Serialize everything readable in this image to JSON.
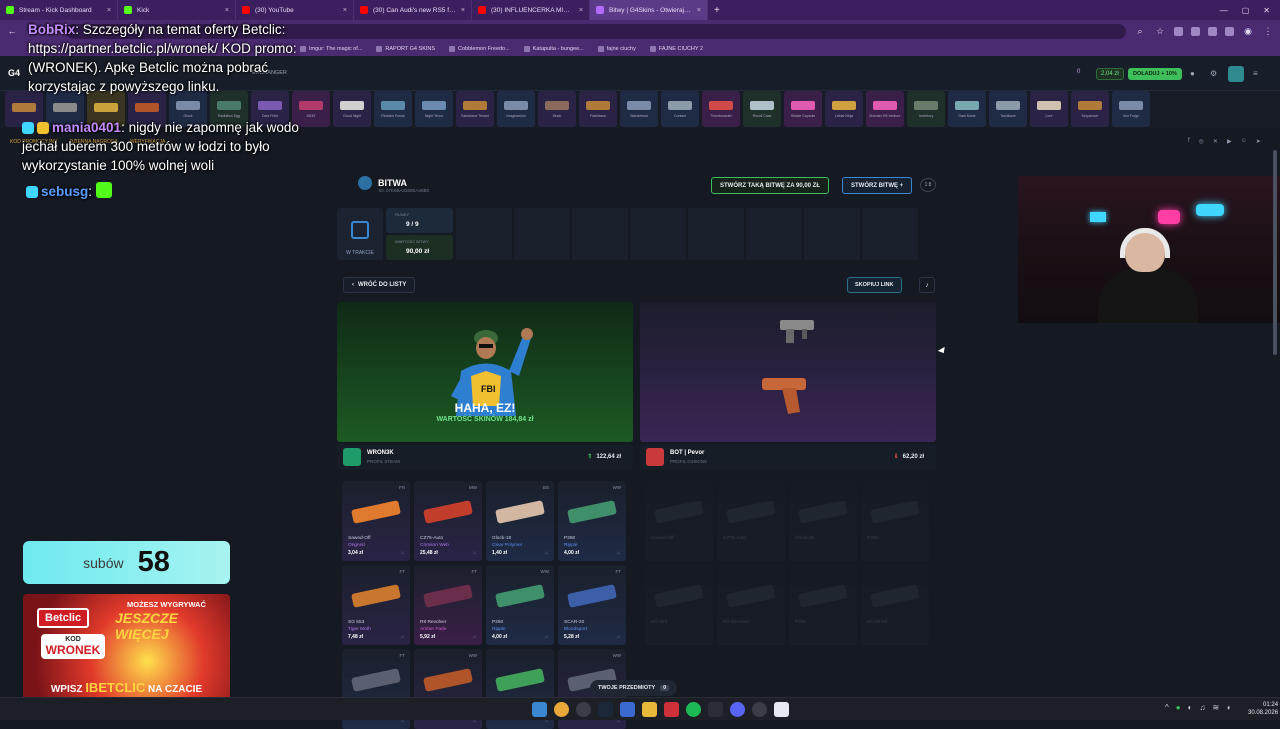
{
  "browser": {
    "tabs": [
      {
        "title": "Stream - Kick Dashboard",
        "color": "#53fc18",
        "active": false
      },
      {
        "title": "Kick",
        "color": "#53fc18",
        "active": false
      },
      {
        "title": "(30) YouTube",
        "color": "#ff0000",
        "active": false
      },
      {
        "title": "(30) Can Audi's new RS5 finally",
        "color": "#ff0000",
        "active": false
      },
      {
        "title": "(30) INFLUENCERKA MIAŻDŻY",
        "color": "#ff0000",
        "active": false
      },
      {
        "title": "Bitwy | G4Skins - Otwieraj skrz",
        "color": "#b06bff",
        "active": true
      }
    ],
    "new_tab": "+",
    "bookmarks": [
      "Imgur: The magic of...",
      "RAPORT G4 SKINS",
      "Cobblemon Freedo...",
      "Katapulta - bungee...",
      "fajne ciuchy",
      "FAJNE CIUCHY 2"
    ]
  },
  "chat": {
    "line1_user": "BobRix",
    "line1_text": ": Szczegóły na temat oferty Betclic: https://partner.betclic.pl/wronek/ KOD promo: (WRONEK). Apkę Betclic można pobrać korzystając z powyższego linku.",
    "line2_user": "mania0401",
    "line2_text": ": nigdy nie zapomnę jak wodo jechał uberem 300 metrów w łodzi to było wykorzystanie 100% wolnej woli",
    "line3_user": "sebusg",
    "line3_text": ":"
  },
  "site": {
    "exchanger": "EXCHANGER",
    "balance": "2,04 zł",
    "deposit": "DOŁADUJ + 10%",
    "coins": "0",
    "promo_links": [
      "KOD PROMOCYJNY",
      "DZIENNA NAGRODA",
      "WERYFIKACJA"
    ]
  },
  "battle": {
    "title": "BITWA",
    "id": "ID: 07E6BA3358EA45B0",
    "create_same": "STWÓRZ TAKĄ BITWĘ ZA 90,00 ZŁ",
    "create_new": "STWÓRZ BITWĘ",
    "fair_badge": "1:8",
    "status": "W TRAKCIE",
    "rounds_label": "RUNDY",
    "rounds_value": "9 / 9",
    "value_label": "WARTOŚĆ BITWY",
    "value_value": "90,00 zł",
    "back": "WRÓĆ DO LISTY",
    "copy_link": "SKOPIUJ LINK",
    "winner_banner": "HAHA, EZ!",
    "winner_skins_value": "WARTOŚĆ SKINÓW 184,84 zł",
    "your_items": "TWOJE PRZEDMIOTY",
    "your_items_count": "0"
  },
  "players": [
    {
      "name": "WRON3K",
      "sub": "PROFIL STEAM",
      "total": "122,64 zł",
      "avatar_color": "#1d9c6a"
    },
    {
      "name": "BOT | Pevor",
      "sub": "PROFIL G4SKINS",
      "total": "62,20 zł",
      "avatar_color": "#c93a3a"
    }
  ],
  "items_left": [
    {
      "cond": "FN",
      "name": "Sawed-Off",
      "skin": "Orignnit",
      "price": "3,04 zł",
      "bg": "#2a2346",
      "gun": "#e07a2e",
      "skin_color": "#b07cf0"
    },
    {
      "cond": "MW",
      "name": "CZ75-Auto",
      "skin": "Crimson Web",
      "price": "25,48 zł",
      "bg": "#2a2346",
      "gun": "#c23d2c",
      "skin_color": "#b07cf0"
    },
    {
      "cond": "BS",
      "name": "Glock-18",
      "skin": "Clear Polymer",
      "price": "1,40 zł",
      "bg": "#1f2a45",
      "gun": "#d2b8a2",
      "skin_color": "#5d8ff0"
    },
    {
      "cond": "WW",
      "name": "P250",
      "skin": "Ripple",
      "price": "4,00 zł",
      "bg": "#1f2a45",
      "gun": "#3f8f6a",
      "skin_color": "#5d8ff0"
    },
    {
      "cond": "FT",
      "name": "SG 553",
      "skin": "Tiger Moth",
      "price": "7,48 zł",
      "bg": "#2a2346",
      "gun": "#c9762e",
      "skin_color": "#b07cf0"
    },
    {
      "cond": "FT",
      "name": "R8 Revolver",
      "skin": "Amber Fade",
      "price": "5,92 zł",
      "bg": "#3a1f48",
      "gun": "#6b2e4a",
      "skin_color": "#d65bd6"
    },
    {
      "cond": "WW",
      "name": "P250",
      "skin": "Ripple",
      "price": "4,00 zł",
      "bg": "#1f2a45",
      "gun": "#3f8f6a",
      "skin_color": "#5d8ff0"
    },
    {
      "cond": "FT",
      "name": "SCAR-20",
      "skin": "Bloodsport",
      "price": "5,28 zł",
      "bg": "#1f2a45",
      "gun": "#3d5fa8",
      "skin_color": "#5d8ff0"
    },
    {
      "cond": "FT",
      "name": "",
      "skin": "",
      "price": "",
      "bg": "#1f2a45",
      "gun": "#5a6070",
      "skin_color": "#5d8ff0"
    },
    {
      "cond": "WW",
      "name": "",
      "skin": "",
      "price": "",
      "bg": "#2a2346",
      "gun": "#b0542a",
      "skin_color": "#b07cf0"
    },
    {
      "cond": "",
      "name": "",
      "skin": "",
      "price": "",
      "bg": "#1f2a45",
      "gun": "#3fa05a",
      "skin_color": "#5d8ff0"
    },
    {
      "cond": "WW",
      "name": "",
      "skin": "",
      "price": "",
      "bg": "#2a2346",
      "gun": "#5a6070",
      "skin_color": "#b07cf0"
    }
  ],
  "items_right": [
    {
      "cond": "",
      "name": "Sawed-Off",
      "skin": "",
      "price": "",
      "bg": "#2a2f3a",
      "gun": "#5a6070",
      "skin_color": "#8a93a4"
    },
    {
      "cond": "",
      "name": "CZ75-Auto",
      "skin": "",
      "price": "",
      "bg": "#2a2f3a",
      "gun": "#5a6070",
      "skin_color": "#8a93a4"
    },
    {
      "cond": "",
      "name": "Glock-18",
      "skin": "",
      "price": "",
      "bg": "#2a2f3a",
      "gun": "#5a6070",
      "skin_color": "#8a93a4"
    },
    {
      "cond": "",
      "name": "P250",
      "skin": "",
      "price": "",
      "bg": "#2a2f3a",
      "gun": "#5a6070",
      "skin_color": "#8a93a4"
    },
    {
      "cond": "",
      "name": "SG 553",
      "skin": "",
      "price": "",
      "bg": "#2a2f3a",
      "gun": "#5a6070",
      "skin_color": "#8a93a4"
    },
    {
      "cond": "",
      "name": "R8 Revolver",
      "skin": "",
      "price": "",
      "bg": "#2a2f3a",
      "gun": "#5a6070",
      "skin_color": "#8a93a4"
    },
    {
      "cond": "",
      "name": "P250",
      "skin": "",
      "price": "",
      "bg": "#2a2f3a",
      "gun": "#5a6070",
      "skin_color": "#8a93a4"
    },
    {
      "cond": "",
      "name": "SCAR-20",
      "skin": "",
      "price": "",
      "bg": "#2a2f3a",
      "gun": "#5a6070",
      "skin_color": "#8a93a4"
    }
  ],
  "drops": [
    {
      "label": "",
      "color": "#b07a3a",
      "bg": "#2a2346"
    },
    {
      "label": "",
      "color": "#8a8a8a",
      "bg": "#1f2a45"
    },
    {
      "label": "",
      "color": "#c9a43a",
      "bg": "#3a3520"
    },
    {
      "label": "",
      "color": "#b0542a",
      "bg": "#2a2346"
    },
    {
      "label": "Glock",
      "color": "#7a8aa8",
      "bg": "#1f2a45"
    },
    {
      "label": "Radiation Egg",
      "color": "#4a7a6a",
      "bg": "#1f2f2a"
    },
    {
      "label": "Dark Field",
      "color": "#7a5ab0",
      "bg": "#2a2346"
    },
    {
      "label": "M249",
      "color": "#b03a6a",
      "bg": "#3a1f48"
    },
    {
      "label": "Cloud Night",
      "color": "#d0d0d0",
      "bg": "#2a2346"
    },
    {
      "label": "Reclaim Funds",
      "color": "#5a8aa8",
      "bg": "#1f2a45"
    },
    {
      "label": "Night Terror",
      "color": "#6a8ab0",
      "bg": "#1f2a45"
    },
    {
      "label": "Sandwave Tenant",
      "color": "#b07a3a",
      "bg": "#2a2346"
    },
    {
      "label": "Imaginarium",
      "color": "#7a8aa8",
      "bg": "#1f2a45"
    },
    {
      "label": "Mudo",
      "color": "#8a6a5a",
      "bg": "#2a2346"
    },
    {
      "label": "Flashback",
      "color": "#b07a3a",
      "bg": "#2a2346"
    },
    {
      "label": "Wanderlust",
      "color": "#7a8aa8",
      "bg": "#1f2a45"
    },
    {
      "label": "Contact",
      "color": "#8a9aa8",
      "bg": "#1f2a45"
    },
    {
      "label": "Thumbmaster",
      "color": "#d04a4a",
      "bg": "#3a1f48"
    },
    {
      "label": "Recoil Case",
      "color": "#b0c0c8",
      "bg": "#1f2f2a"
    },
    {
      "label": "Sticker Capsule",
      "color": "#e05ab0",
      "bg": "#3a1f48"
    },
    {
      "label": "Lethal Ninja",
      "color": "#d0a040",
      "bg": "#2a2346"
    },
    {
      "label": "Monster Eft Venture",
      "color": "#e05ab0",
      "bg": "#3a1f48"
    },
    {
      "label": "Inventory",
      "color": "#6a7a6a",
      "bg": "#1f2f2a"
    },
    {
      "label": "Dark Mode",
      "color": "#7aa8b0",
      "bg": "#1f2a45"
    },
    {
      "label": "Tachikaze",
      "color": "#8a9aa8",
      "bg": "#1f2a45"
    },
    {
      "label": "Lore",
      "color": "#d0c0b0",
      "bg": "#2a2346"
    },
    {
      "label": "Sequencer",
      "color": "#b07a3a",
      "bg": "#2a2346"
    },
    {
      "label": "Iron Forge",
      "color": "#7a8aa8",
      "bg": "#1f2a45"
    }
  ],
  "stream": {
    "subs_label": "subów",
    "subs_count": "58",
    "ad_brand": "Betclic",
    "ad_line1": "MOŻESZ WYGRYWAĆ",
    "ad_line2": "JESZCZE WIĘCEJ",
    "ad_kod": "KOD",
    "ad_code": "WRONEK",
    "ad_wpisz_prefix": "WPISZ",
    "ad_wpisz_code": "IBETCLIC",
    "ad_wpisz_suffix": "NA CZACIE"
  },
  "system": {
    "time": "01:24",
    "date": "30.08.2026"
  },
  "colors": {
    "accent_green": "#3fbf5c",
    "accent_blue": "#3b88d1",
    "accent_red": "#e0484f",
    "chat_user_blue": "#5b9bff",
    "chat_user_purple": "#c28bff"
  }
}
